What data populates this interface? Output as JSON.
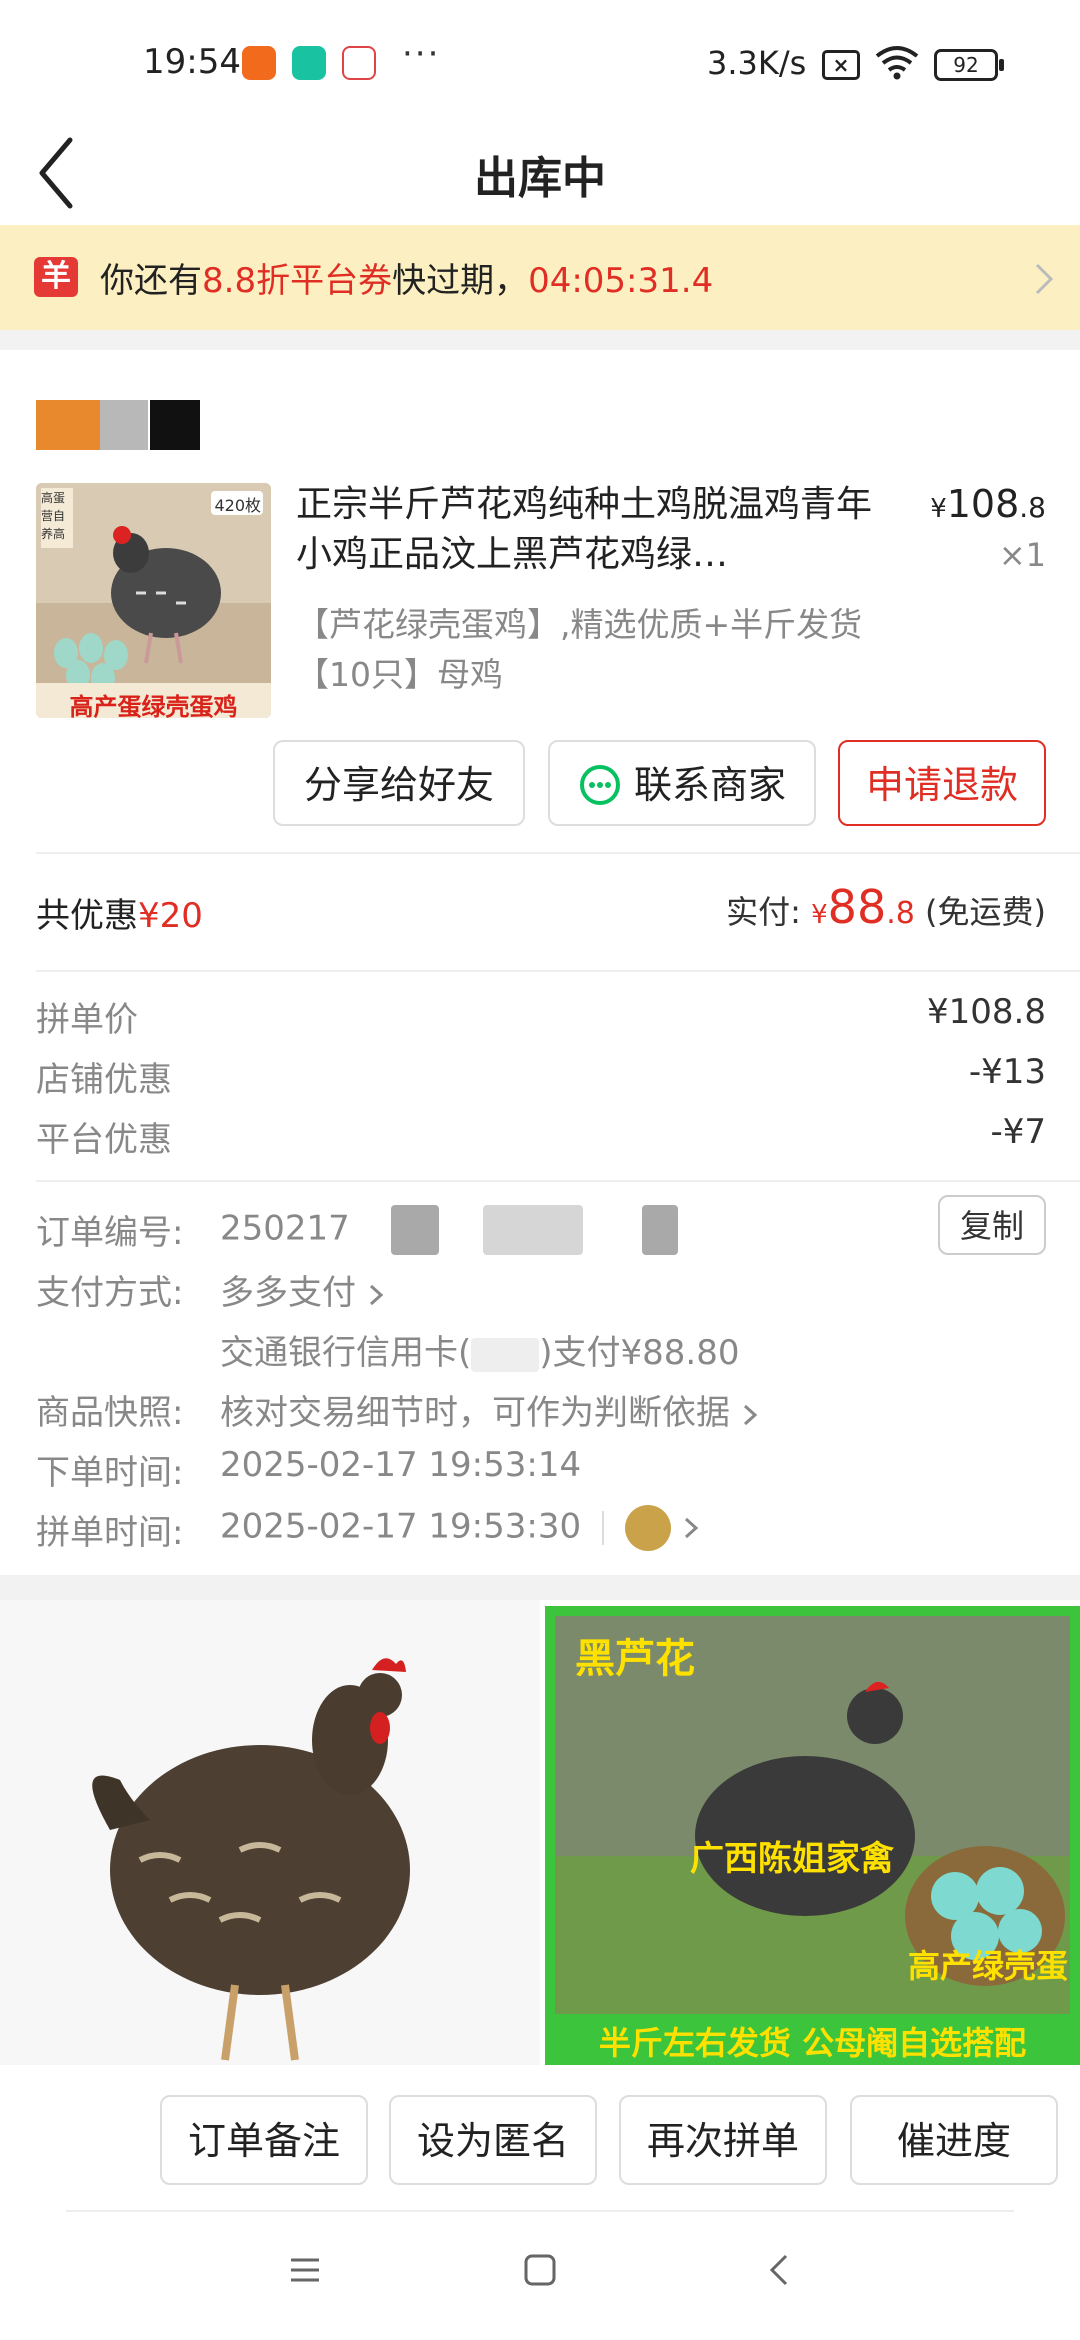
{
  "status_bar": {
    "time": "19:54",
    "dots": "···",
    "net_speed": "3.3K/s",
    "battery": "92"
  },
  "header": {
    "title": "出库中"
  },
  "coupon_banner": {
    "icon_char": "羊",
    "text_prefix": "你还有",
    "highlight": "8.8折平台券",
    "text_suffix": "快过期，",
    "countdown": "04:05:31.4"
  },
  "product": {
    "title": "正宗半斤芦花鸡纯种土鸡脱温鸡青年小鸡正品汶上黑芦花鸡绿…",
    "spec": "【芦花绿壳蛋鸡】,精选优质+半斤发货【10只】母鸡",
    "price_symbol": "¥",
    "price_int": "108",
    "price_dec": ".8",
    "quantity": "×1",
    "image_caption": "高产蛋绿壳蛋鸡",
    "image_badge": "420枚",
    "image_tag": "高蛋 营自 养高"
  },
  "actions": {
    "share": "分享给好友",
    "contact": "联系商家",
    "refund": "申请退款"
  },
  "totals": {
    "discount_label": "共优惠",
    "discount_value": "¥20",
    "paid_label": "实付:",
    "paid_symbol": "¥",
    "paid_int": "88",
    "paid_dec": ".8",
    "shipping_note": "(免运费)"
  },
  "fees": [
    {
      "label": "拼单价",
      "value": "¥108.8"
    },
    {
      "label": "店铺优惠",
      "value": "-¥13"
    },
    {
      "label": "平台优惠",
      "value": "-¥7"
    }
  ],
  "order_info": {
    "order_no_label": "订单编号:",
    "order_no_visible": "250217",
    "copy_label": "复制",
    "payment_label": "支付方式:",
    "payment_value": "多多支付",
    "payment_detail_prefix": "交通银行信用卡(",
    "payment_detail_suffix": ")支付¥88.80",
    "snapshot_label": "商品快照:",
    "snapshot_value": "核对交易细节时，可作为判断依据",
    "order_time_label": "下单时间:",
    "order_time_value": "2025-02-17 19:53:14",
    "group_time_label": "拼单时间:",
    "group_time_value": "2025-02-17 19:53:30"
  },
  "gallery": {
    "right_title": "黑芦花",
    "right_brand": "广西陈姐家禽",
    "right_sub": "高产绿壳蛋",
    "right_footer": "半斤左右发货 公母阉自选搭配"
  },
  "bottom_actions": {
    "note": "订单备注",
    "anonymous": "设为匿名",
    "reorder": "再次拼单",
    "urge": "催进度"
  },
  "colors": {
    "accent": "#e02e24",
    "banner_bg": "#fcf0c2",
    "wechat_green": "#07c160"
  }
}
